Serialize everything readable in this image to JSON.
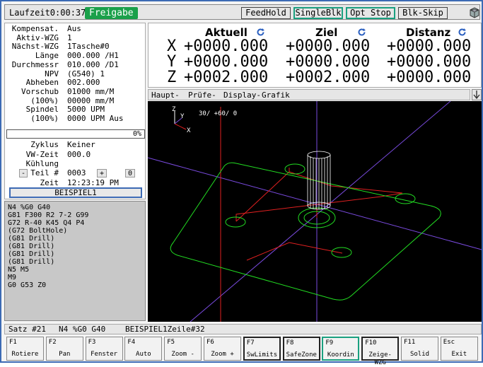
{
  "topbar": {
    "runtime": "Laufzeit0:00:37",
    "status": "Freigabe",
    "buttons": [
      "FeedHold",
      "SingleBlk",
      "Opt Stop",
      "Blk-Skip"
    ]
  },
  "info": {
    "rows": [
      {
        "label": "Kompensat.",
        "value": "Aus"
      },
      {
        "label": "Aktiv-WZG",
        "value": "1"
      },
      {
        "label": "Nächst-WZG",
        "value": "1Tasche#0"
      },
      {
        "label": "Länge",
        "value": "000.000 /H1"
      },
      {
        "label": "Durchmessr",
        "value": "010.000 /D1"
      },
      {
        "label": "NPV",
        "value": "(G540) 1"
      },
      {
        "label": "Abheben",
        "value": "002.000"
      },
      {
        "label": "Vorschub",
        "value": "01000 mm/M"
      },
      {
        "label": "(100%)",
        "value": "00000 mm/M"
      },
      {
        "label": "Spindel",
        "value": "5000 UPM"
      },
      {
        "label": "(100%)",
        "value": "0000 UPM Aus"
      }
    ],
    "progress": 0,
    "progress_text": "0%",
    "rows2": [
      {
        "label": "Zyklus",
        "value": "Keiner"
      },
      {
        "label": "VW-Zeit",
        "value": "000.0"
      },
      {
        "label": "Kühlung",
        "value": ""
      }
    ],
    "teil_minus": "-",
    "teil_label": "Teil #",
    "teil_value": "0003",
    "teil_plus": "+",
    "teil_reset": "0",
    "zeit_label": "Zeit",
    "zeit_value": "12:23:19 PM",
    "program_name": "BEISPIEL1"
  },
  "gcode": [
    "N4 %G0 G40",
    "G81 F300 R2 7-2 G99",
    "G72 R-40 K45 Q4 P4",
    "(G72 BoltHole)",
    "(G81 Drill)",
    "(G81 Drill)",
    "(G81 Drill)",
    "(G81 Drill)",
    "N5 M5",
    "M9",
    "G0 G53 Z0"
  ],
  "dro": {
    "headers": [
      "Aktuell",
      "Ziel",
      "Distanz"
    ],
    "axes": [
      {
        "axis": "X",
        "aktuell": "+0000.000",
        "ziel": "+0000.000",
        "distanz": "+0000.000"
      },
      {
        "axis": "Y",
        "aktuell": "+0000.000",
        "ziel": "+0000.000",
        "distanz": "+0000.000"
      },
      {
        "axis": "Z",
        "aktuell": "+0002.000",
        "ziel": "+0002.000",
        "distanz": "+0000.000"
      }
    ]
  },
  "graphics": {
    "tabs": [
      "Haupt-",
      "Prüfe-",
      "Display-",
      "Grafik"
    ],
    "view_angle": "30/ +60/ 0",
    "axis_labels": [
      "Z",
      "Y",
      "X"
    ]
  },
  "statusline": {
    "satz": "Satz #21",
    "block": "N4 %G0 G40",
    "program": "BEISPIEL1Zeile#32"
  },
  "fkeys": [
    {
      "key": "F1",
      "label": "Rotiere",
      "style": "normal"
    },
    {
      "key": "F2",
      "label": "Pan",
      "style": "normal"
    },
    {
      "key": "F3",
      "label": "Fenster",
      "style": "normal"
    },
    {
      "key": "F4",
      "label": "Auto",
      "style": "normal"
    },
    {
      "key": "F5",
      "label": "Zoom -",
      "style": "normal"
    },
    {
      "key": "F6",
      "label": "Zoom +",
      "style": "normal"
    },
    {
      "key": "F7",
      "label": "SwLimits",
      "style": "dark"
    },
    {
      "key": "F8",
      "label": "SafeZone",
      "style": "dark"
    },
    {
      "key": "F9",
      "label": "Koordin",
      "style": "green"
    },
    {
      "key": "F10",
      "label": "Zeige-WZG",
      "style": "dark"
    },
    {
      "key": "F11",
      "label": "Solid",
      "style": "normal"
    },
    {
      "key": "Esc",
      "label": "Exit",
      "style": "normal"
    }
  ],
  "colors": {
    "accent_blue": "#3c6ab4",
    "status_green": "#1aa04a",
    "toggle_green": "#1aa080",
    "toolpath_green": "#22dd22",
    "rapid_red": "#e02020",
    "axis_purple": "#7a4be0"
  }
}
